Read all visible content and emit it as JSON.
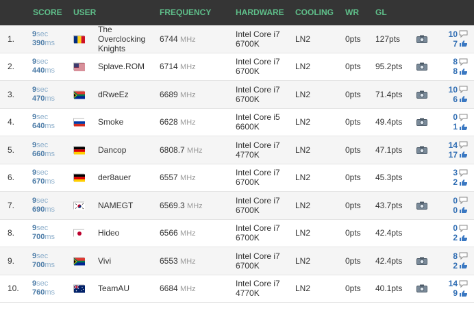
{
  "columns": {
    "score": "SCORE",
    "user": "USER",
    "frequency": "FREQUENCY",
    "hardware": "HARDWARE",
    "cooling": "COOLING",
    "wr": "WR",
    "gl": "GL"
  },
  "rows": [
    {
      "rank": "1.",
      "score_sec": "9",
      "score_sec_unit": "sec",
      "score_ms": "390",
      "score_ms_unit": "ms",
      "flag": "romania",
      "user_line1": "The",
      "user_line2": "Overclocking",
      "user_line3": "Knights",
      "freq": "6744",
      "freq_unit": "MHz",
      "hw1": "Intel Core i7",
      "hw2": "6700K",
      "cooling": "LN2",
      "wr": "0pts",
      "gl": "127pts",
      "camera": true,
      "comments": "10",
      "likes": "7"
    },
    {
      "rank": "2.",
      "score_sec": "9",
      "score_sec_unit": "sec",
      "score_ms": "440",
      "score_ms_unit": "ms",
      "flag": "usa",
      "user_line1": "Splave.ROM",
      "user_line2": "",
      "user_line3": "",
      "freq": "6714",
      "freq_unit": "MHz",
      "hw1": "Intel Core i7",
      "hw2": "6700K",
      "cooling": "LN2",
      "wr": "0pts",
      "gl": "95.2pts",
      "camera": true,
      "comments": "8",
      "likes": "8"
    },
    {
      "rank": "3.",
      "score_sec": "9",
      "score_sec_unit": "sec",
      "score_ms": "470",
      "score_ms_unit": "ms",
      "flag": "south-africa",
      "user_line1": "dRweEz",
      "user_line2": "",
      "user_line3": "",
      "freq": "6689",
      "freq_unit": "MHz",
      "hw1": "Intel Core i7",
      "hw2": "6700K",
      "cooling": "LN2",
      "wr": "0pts",
      "gl": "71.4pts",
      "camera": true,
      "comments": "10",
      "likes": "6"
    },
    {
      "rank": "4.",
      "score_sec": "9",
      "score_sec_unit": "sec",
      "score_ms": "640",
      "score_ms_unit": "ms",
      "flag": "russia",
      "user_line1": "Smoke",
      "user_line2": "",
      "user_line3": "",
      "freq": "6628",
      "freq_unit": "MHz",
      "hw1": "Intel Core i5",
      "hw2": "6600K",
      "cooling": "LN2",
      "wr": "0pts",
      "gl": "49.4pts",
      "camera": true,
      "comments": "0",
      "likes": "1"
    },
    {
      "rank": "5.",
      "score_sec": "9",
      "score_sec_unit": "sec",
      "score_ms": "660",
      "score_ms_unit": "ms",
      "flag": "germany",
      "user_line1": "Dancop",
      "user_line2": "",
      "user_line3": "",
      "freq": "6808.7",
      "freq_unit": "MHz",
      "hw1": "Intel Core i7",
      "hw2": "4770K",
      "cooling": "LN2",
      "wr": "0pts",
      "gl": "47.1pts",
      "camera": true,
      "comments": "14",
      "likes": "17"
    },
    {
      "rank": "6.",
      "score_sec": "9",
      "score_sec_unit": "sec",
      "score_ms": "670",
      "score_ms_unit": "ms",
      "flag": "germany",
      "user_line1": "der8auer",
      "user_line2": "",
      "user_line3": "",
      "freq": "6557",
      "freq_unit": "MHz",
      "hw1": "Intel Core i7",
      "hw2": "6700K",
      "cooling": "LN2",
      "wr": "0pts",
      "gl": "45.3pts",
      "camera": false,
      "comments": "3",
      "likes": "2"
    },
    {
      "rank": "7.",
      "score_sec": "9",
      "score_sec_unit": "sec",
      "score_ms": "690",
      "score_ms_unit": "ms",
      "flag": "south-korea",
      "user_line1": "NAMEGT",
      "user_line2": "",
      "user_line3": "",
      "freq": "6569.3",
      "freq_unit": "MHz",
      "hw1": "Intel Core i7",
      "hw2": "6700K",
      "cooling": "LN2",
      "wr": "0pts",
      "gl": "43.7pts",
      "camera": true,
      "comments": "0",
      "likes": "0"
    },
    {
      "rank": "8.",
      "score_sec": "9",
      "score_sec_unit": "sec",
      "score_ms": "700",
      "score_ms_unit": "ms",
      "flag": "japan",
      "user_line1": "Hideo",
      "user_line2": "",
      "user_line3": "",
      "freq": "6566",
      "freq_unit": "MHz",
      "hw1": "Intel Core i7",
      "hw2": "6700K",
      "cooling": "LN2",
      "wr": "0pts",
      "gl": "42.4pts",
      "camera": false,
      "comments": "0",
      "likes": "2"
    },
    {
      "rank": "9.",
      "score_sec": "9",
      "score_sec_unit": "sec",
      "score_ms": "700",
      "score_ms_unit": "ms",
      "flag": "south-africa",
      "user_line1": "Vivi",
      "user_line2": "",
      "user_line3": "",
      "freq": "6553",
      "freq_unit": "MHz",
      "hw1": "Intel Core i7",
      "hw2": "6700K",
      "cooling": "LN2",
      "wr": "0pts",
      "gl": "42.4pts",
      "camera": true,
      "comments": "8",
      "likes": "2"
    },
    {
      "rank": "10.",
      "score_sec": "9",
      "score_sec_unit": "sec",
      "score_ms": "760",
      "score_ms_unit": "ms",
      "flag": "australia",
      "user_line1": "TeamAU",
      "user_line2": "",
      "user_line3": "",
      "freq": "6684",
      "freq_unit": "MHz",
      "hw1": "Intel Core i7",
      "hw2": "4770K",
      "cooling": "LN2",
      "wr": "0pts",
      "gl": "40.1pts",
      "camera": true,
      "comments": "14",
      "likes": "9"
    }
  ],
  "colors": {
    "header_bg": "#353535",
    "header_text": "#5fbf8a",
    "score": "#4a7aa6",
    "votes": "#2f6db3",
    "row_alt": "#f5f5f5"
  },
  "icons": {
    "camera": "camera-icon",
    "comment": "comment-bubble-icon",
    "like": "thumbs-up-icon"
  }
}
